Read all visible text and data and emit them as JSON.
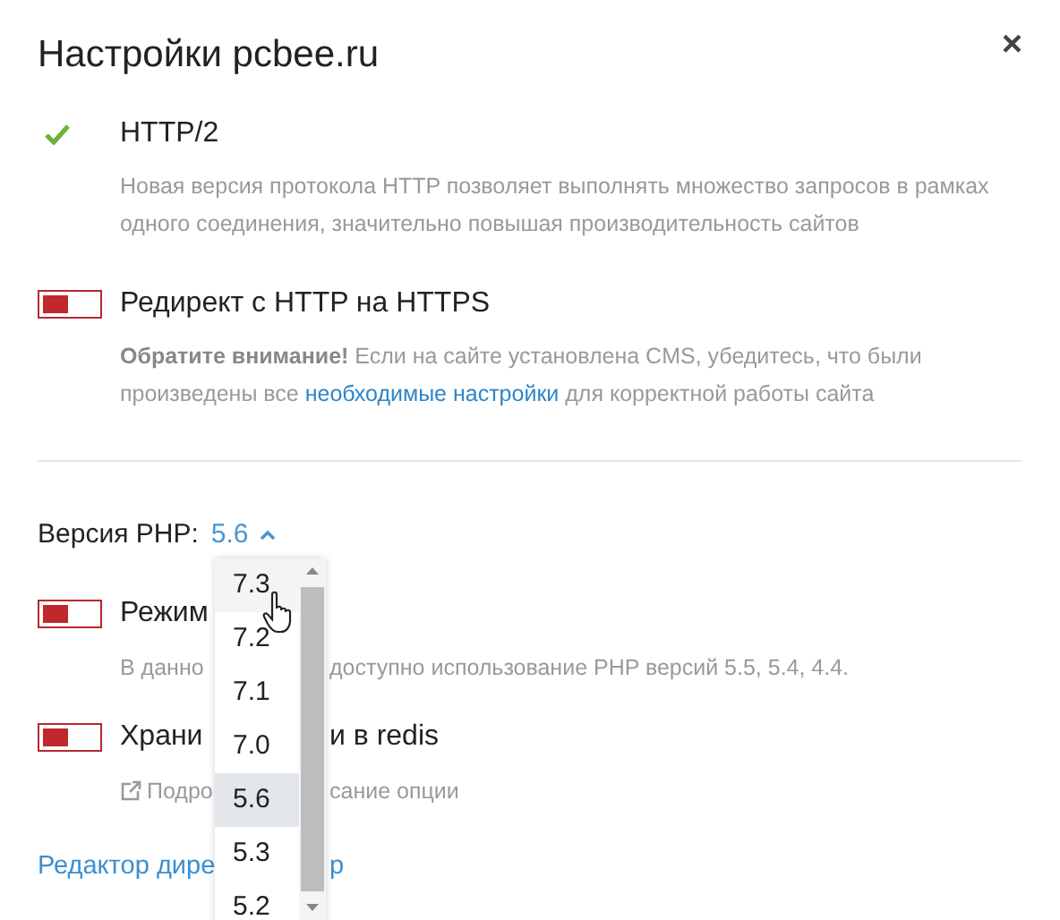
{
  "dialog": {
    "title": "Настройки pcbee.ru",
    "close": "×"
  },
  "features": [
    {
      "kind": "check",
      "checked": true,
      "title": "HTTP/2",
      "description": "Новая версия протокола HTTP позволяет выполнять множество запросов в рамках одного соединения, значительно повышая производительность сайтов"
    },
    {
      "kind": "toggle",
      "on": false,
      "title": "Редирект с HTTP на HTTPS",
      "description": "**Обратите внимание!** Если на сайте установлена CMS, убедитесь, что были произведены все ",
      "link": "необходимые настройки",
      "description_end": " для корректной работы сайта"
    }
  ],
  "php": {
    "label": "Версия PHP:",
    "value": "5.6",
    "expanded": true,
    "options": [
      {
        "label": "7.3",
        "hovered": true,
        "selected": false
      },
      {
        "label": "7.2",
        "hovered": false,
        "selected": false
      },
      {
        "label": "7.1",
        "hovered": false,
        "selected": false
      },
      {
        "label": "7.0",
        "hovered": false,
        "selected": false
      },
      {
        "label": "5.6",
        "hovered": false,
        "selected": true
      },
      {
        "label": "5.3",
        "hovered": false,
        "selected": false
      },
      {
        "label": "5.2",
        "hovered": false,
        "selected": false
      }
    ]
  },
  "covered_features": [
    {
      "on": false,
      "title_parts": [
        "Режим"
      ],
      "kind": "text",
      "description_parts": [
        "В данно",
        "доступно использование PHP версий 5.5, 5.4, 4.4."
      ]
    },
    {
      "on": false,
      "title_parts": [
        "Храни",
        "и в redis"
      ],
      "kind": "link",
      "description_parts": [
        "Подро",
        "сание опции"
      ]
    }
  ],
  "footer_link_parts": [
    "Редактор дире",
    "р"
  ]
}
